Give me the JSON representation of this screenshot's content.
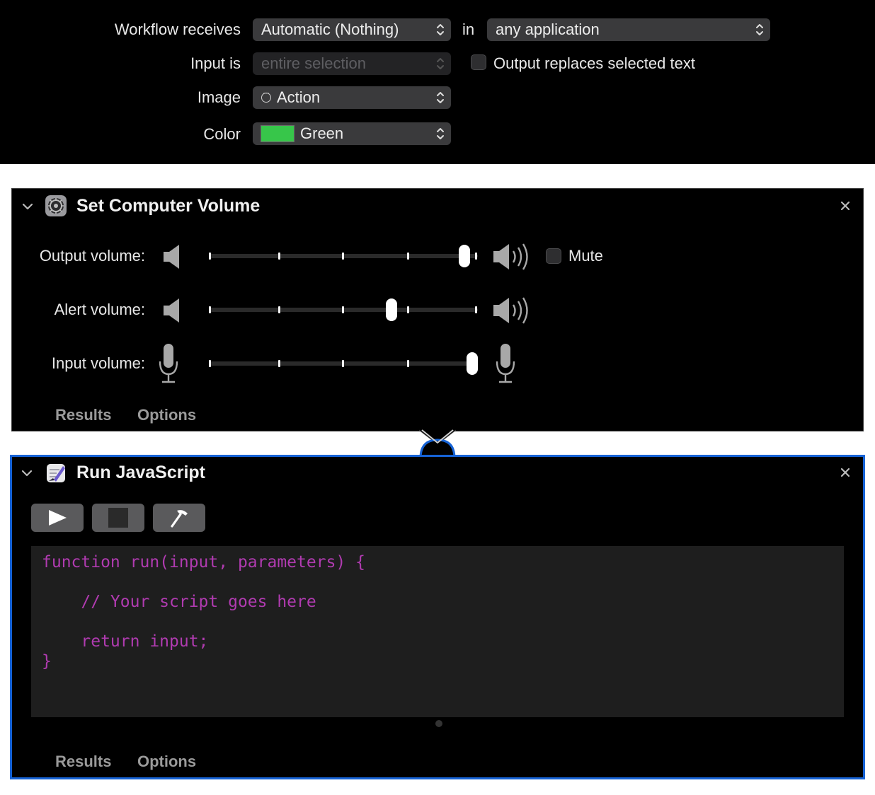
{
  "settings": {
    "workflow_receives_label": "Workflow receives",
    "workflow_receives_value": "Automatic (Nothing)",
    "in_label": "in",
    "application_value": "any application",
    "input_is_label": "Input is",
    "input_is_value": "entire selection",
    "output_replaces_label": "Output replaces selected text",
    "output_replaces_checked": false,
    "image_label": "Image",
    "image_value": "Action",
    "color_label": "Color",
    "color_value": "Green",
    "color_swatch": "#37c64a"
  },
  "volume_action": {
    "title": "Set Computer Volume",
    "icon": "system-preferences-icon",
    "output_label": "Output volume:",
    "alert_label": "Alert volume:",
    "input_label": "Input volume:",
    "output_level": 0.95,
    "alert_level": 0.68,
    "input_level": 0.98,
    "mute_label": "Mute",
    "mute_checked": false,
    "tabs": [
      "Results",
      "Options"
    ]
  },
  "js_action": {
    "title": "Run JavaScript",
    "icon": "script-editor-icon",
    "toolbar": [
      "run-icon",
      "stop-icon",
      "compile-hammer-icon"
    ],
    "code": [
      "function run(input, parameters) {",
      "",
      "    // Your script goes here",
      "",
      "    return input;",
      "}"
    ],
    "tabs": [
      "Results",
      "Options"
    ]
  },
  "colors": {
    "accent": "#1663d6",
    "code": "#b03bb0",
    "background": "#000000"
  }
}
